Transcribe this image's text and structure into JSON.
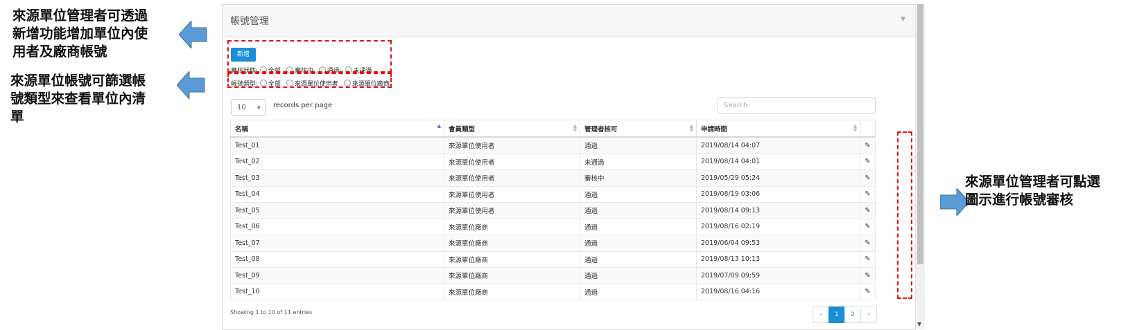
{
  "annotations": {
    "add_note": [
      "來源單位管理者可透過",
      "新增功能增加單位內使",
      "用者及廠商帳號"
    ],
    "filter_note": [
      "來源單位帳號可篩選帳",
      "號類型來查看單位內清",
      "單"
    ],
    "edit_note": [
      "來源單位管理者可點選",
      "圖示進行帳號審核"
    ]
  },
  "panel": {
    "title": "帳號管理",
    "add_button": "新增",
    "status_filter": {
      "label": "審核狀態:",
      "options": [
        "全部",
        "審核中",
        "通過",
        "未通過"
      ]
    },
    "type_filter": {
      "label": "帳號類型:",
      "options": [
        "全部",
        "來源單位使用者",
        "來源單位廠商"
      ]
    },
    "page_length": "10",
    "page_length_label": "records per page",
    "search_placeholder": "Search"
  },
  "table": {
    "columns": [
      "名稱",
      "會員類型",
      "管理者核可",
      "申請時間"
    ],
    "rows": [
      {
        "name": "Test_01",
        "type": "來源單位使用者",
        "approval": "通過",
        "time": "2019/08/14 04:07"
      },
      {
        "name": "Test_02",
        "type": "來源單位使用者",
        "approval": "未通過",
        "time": "2019/08/14 04:01"
      },
      {
        "name": "Test_03",
        "type": "來源單位使用者",
        "approval": "審核中",
        "time": "2019/05/29 05:24"
      },
      {
        "name": "Test_04",
        "type": "來源單位使用者",
        "approval": "通過",
        "time": "2019/08/19 03:06"
      },
      {
        "name": "Test_05",
        "type": "來源單位使用者",
        "approval": "通過",
        "time": "2019/08/14 09:13"
      },
      {
        "name": "Test_06",
        "type": "來源單位廠商",
        "approval": "通過",
        "time": "2019/08/16 02:19"
      },
      {
        "name": "Test_07",
        "type": "來源單位廠商",
        "approval": "通過",
        "time": "2019/06/04 09:53"
      },
      {
        "name": "Test_08",
        "type": "來源單位廠商",
        "approval": "通過",
        "time": "2019/08/13 10:13"
      },
      {
        "name": "Test_09",
        "type": "來源單位廠商",
        "approval": "通過",
        "time": "2019/07/09 09:59"
      },
      {
        "name": "Test_10",
        "type": "來源單位廠商",
        "approval": "通過",
        "time": "2019/08/16 04:16"
      }
    ]
  },
  "footer": {
    "info": "Showing 1 to 10 of 11 entries",
    "pages": [
      "‹",
      "1",
      "2",
      "›"
    ]
  },
  "colors": {
    "primary": "#1a8fd5",
    "pending": "#e03c3c",
    "highlight": "#e01010",
    "arrow": "#5b9bd5"
  },
  "icons": {
    "edit": "pencil-icon",
    "arrow": "arrow-left-icon / arrow-right-icon"
  }
}
